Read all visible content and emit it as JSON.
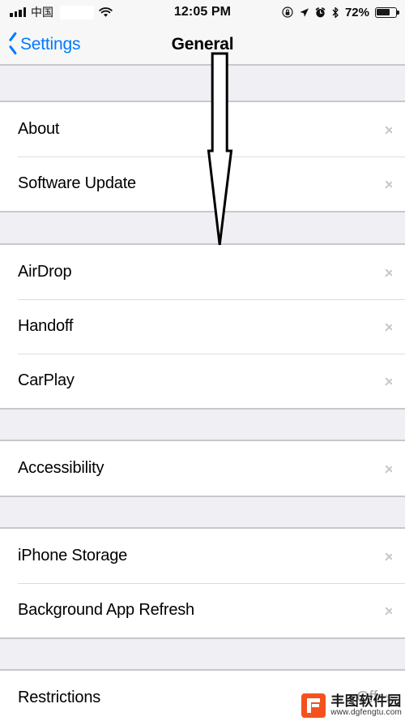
{
  "status_bar": {
    "signal_icon": "signal-bars-icon",
    "signal_bars": 4,
    "carrier": "中国",
    "wifi_icon": "wifi-icon",
    "time": "12:05 PM",
    "rotation_lock_icon": "rotation-lock-icon",
    "location_icon": "location-arrow-icon",
    "alarm_icon": "alarm-clock-icon",
    "bluetooth_icon": "bluetooth-icon",
    "battery_percent": "72%",
    "battery_level": 72,
    "battery_icon": "battery-icon"
  },
  "nav_bar": {
    "back_label": "Settings",
    "back_icon": "chevron-left-icon",
    "title": "General"
  },
  "groups": [
    {
      "rows": [
        {
          "label": "About",
          "value": "",
          "accessory": "chevron-right-icon"
        },
        {
          "label": "Software Update",
          "value": "",
          "accessory": "chevron-right-icon"
        }
      ]
    },
    {
      "rows": [
        {
          "label": "AirDrop",
          "value": "",
          "accessory": "chevron-right-icon"
        },
        {
          "label": "Handoff",
          "value": "",
          "accessory": "chevron-right-icon"
        },
        {
          "label": "CarPlay",
          "value": "",
          "accessory": "chevron-right-icon"
        }
      ]
    },
    {
      "rows": [
        {
          "label": "Accessibility",
          "value": "",
          "accessory": "chevron-right-icon"
        }
      ]
    },
    {
      "rows": [
        {
          "label": "iPhone Storage",
          "value": "",
          "accessory": "chevron-right-icon"
        },
        {
          "label": "Background App Refresh",
          "value": "",
          "accessory": "chevron-right-icon"
        }
      ]
    },
    {
      "rows": [
        {
          "label": "Restrictions",
          "value": "Off",
          "accessory": "chevron-right-icon"
        }
      ]
    }
  ],
  "annotation": {
    "type": "down-arrow",
    "color": "#000000"
  },
  "watermark": {
    "logo_icon": "fengtu-logo-icon",
    "name": "丰图软件园",
    "url": "www.dgfengtu.com",
    "accent_color": "#f4511e"
  }
}
